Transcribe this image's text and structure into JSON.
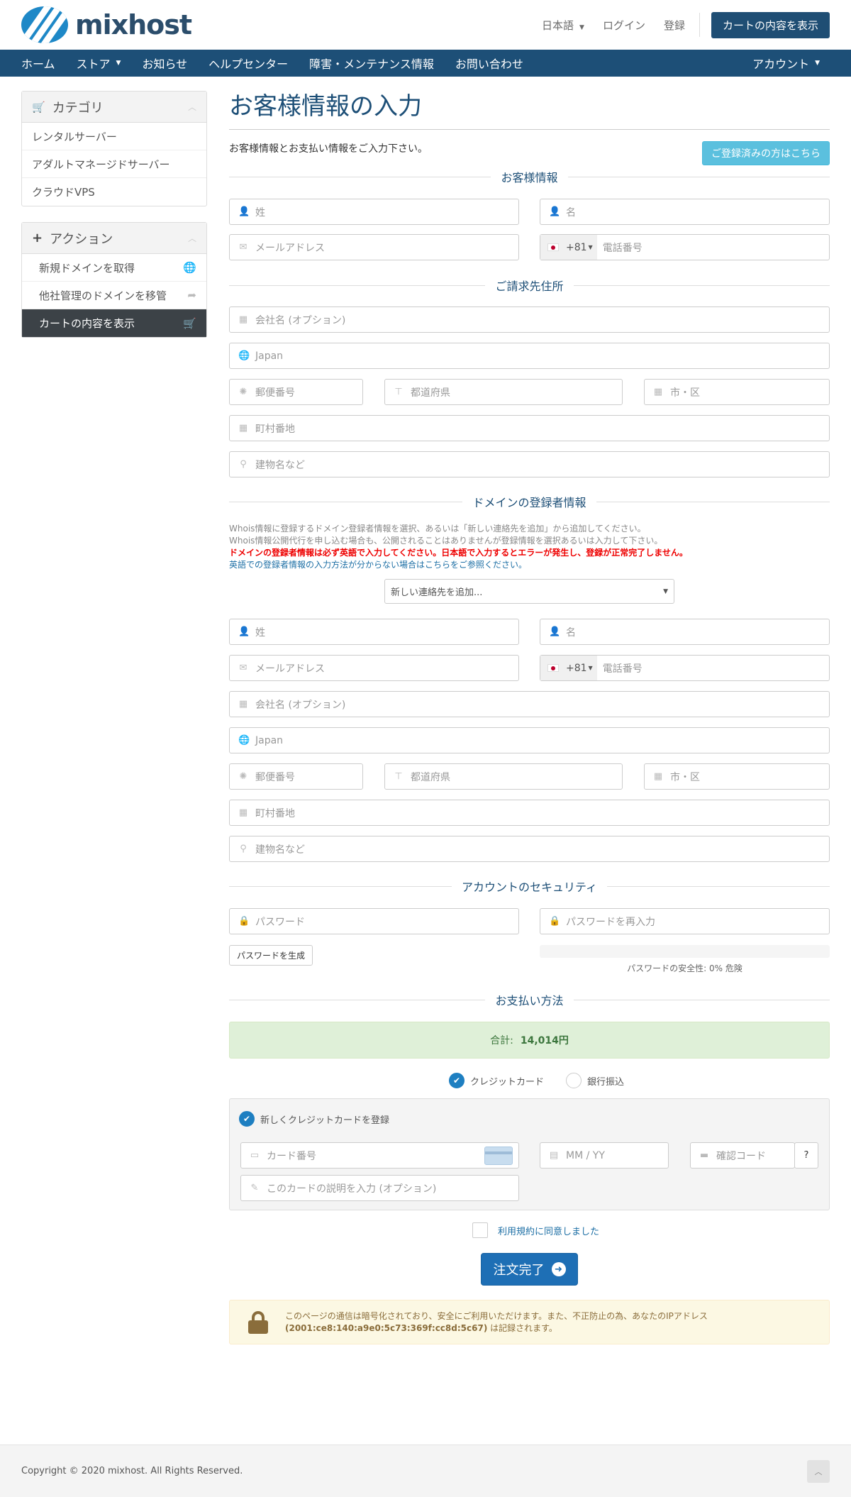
{
  "header": {
    "brand": "mixhost",
    "language_label": "日本語",
    "login_label": "ログイン",
    "register_label": "登録",
    "cart_button_label": "カートの内容を表示"
  },
  "nav": {
    "items": [
      "ホーム",
      "ストア",
      "お知らせ",
      "ヘルプセンター",
      "障害・メンテナンス情報",
      "お問い合わせ"
    ],
    "account_label": "アカウント"
  },
  "sidebar": {
    "categories": {
      "title": "カテゴリ",
      "items": [
        "レンタルサーバー",
        "アダルトマネージドサーバー",
        "クラウドVPS"
      ]
    },
    "actions": {
      "title": "アクション",
      "items": [
        "新規ドメインを取得",
        "他社管理のドメインを移管",
        "カートの内容を表示"
      ]
    }
  },
  "page": {
    "title": "お客様情報の入力",
    "intro": "お客様情報とお支払い情報をご入力下さい。",
    "existing_customer_button": "ご登録済みの方はこちら"
  },
  "sections": {
    "customer_info": "お客様情報",
    "billing_address": "ご請求先住所",
    "domain_registrant": "ドメインの登録者情報",
    "account_security": "アカウントのセキュリティ",
    "payment_method": "お支払い方法"
  },
  "placeholders": {
    "last_name": "姓",
    "first_name": "名",
    "email": "メールアドレス",
    "phone": "電話番号",
    "company": "会社名 (オプション)",
    "country": "Japan",
    "postcode": "郵便番号",
    "prefecture": "都道府県",
    "city": "市・区",
    "address1": "町村番地",
    "address2": "建物名など",
    "password": "パスワード",
    "password_confirm": "パスワードを再入力",
    "card_number": "カード番号",
    "expiry": "MM / YY",
    "cvv": "確認コード",
    "card_description": "このカードの説明を入力 (オプション)"
  },
  "phone_prefix": "+81",
  "whois": {
    "line1": "Whois情報に登録するドメイン登録者情報を選択、あるいは「新しい連絡先を追加」から追加してください。",
    "line2": "Whois情報公開代行を申し込む場合も、公開されることはありませんが登録情報を選択あるいは入力して下さい。",
    "warning": "ドメインの登録者情報は必ず英語で入力してください。日本語で入力するとエラーが発生し、登録が正常完了しません。",
    "help_link": "英語での登録者情報の入力方法が分からない場合はこちらをご参照ください。",
    "contact_select": "新しい連絡先を追加..."
  },
  "security": {
    "generate_button": "パスワードを生成",
    "strength_text": "パスワードの安全性: 0% 危険",
    "strength_percent": 0
  },
  "payment": {
    "total_label": "合計:",
    "total_value": "14,014円",
    "methods": [
      "クレジットカード",
      "銀行振込"
    ],
    "selected_method": "クレジットカード",
    "new_card_label": "新しくクレジットカードを登録",
    "cvv_help": "?"
  },
  "agree_label": "利用規約に同意しました",
  "order_button": "注文完了",
  "secure_notice": {
    "text_before": "このページの通信は暗号化されており、安全にご利用いただけます。また、不正防止の為、あなたのIPアドレス",
    "ip": "(2001:ce8:140:a9e0:5c73:369f:cc8d:5c67)",
    "text_after": " は記録されます。"
  },
  "footer": {
    "copyright": "Copyright © 2020 mixhost. All Rights Reserved."
  },
  "colors": {
    "brand": "#1d4f77",
    "accent": "#1e88c7",
    "info_button": "#5bc0de",
    "success_bg": "#dff0d8",
    "warning_bg": "#fcf8e3"
  }
}
